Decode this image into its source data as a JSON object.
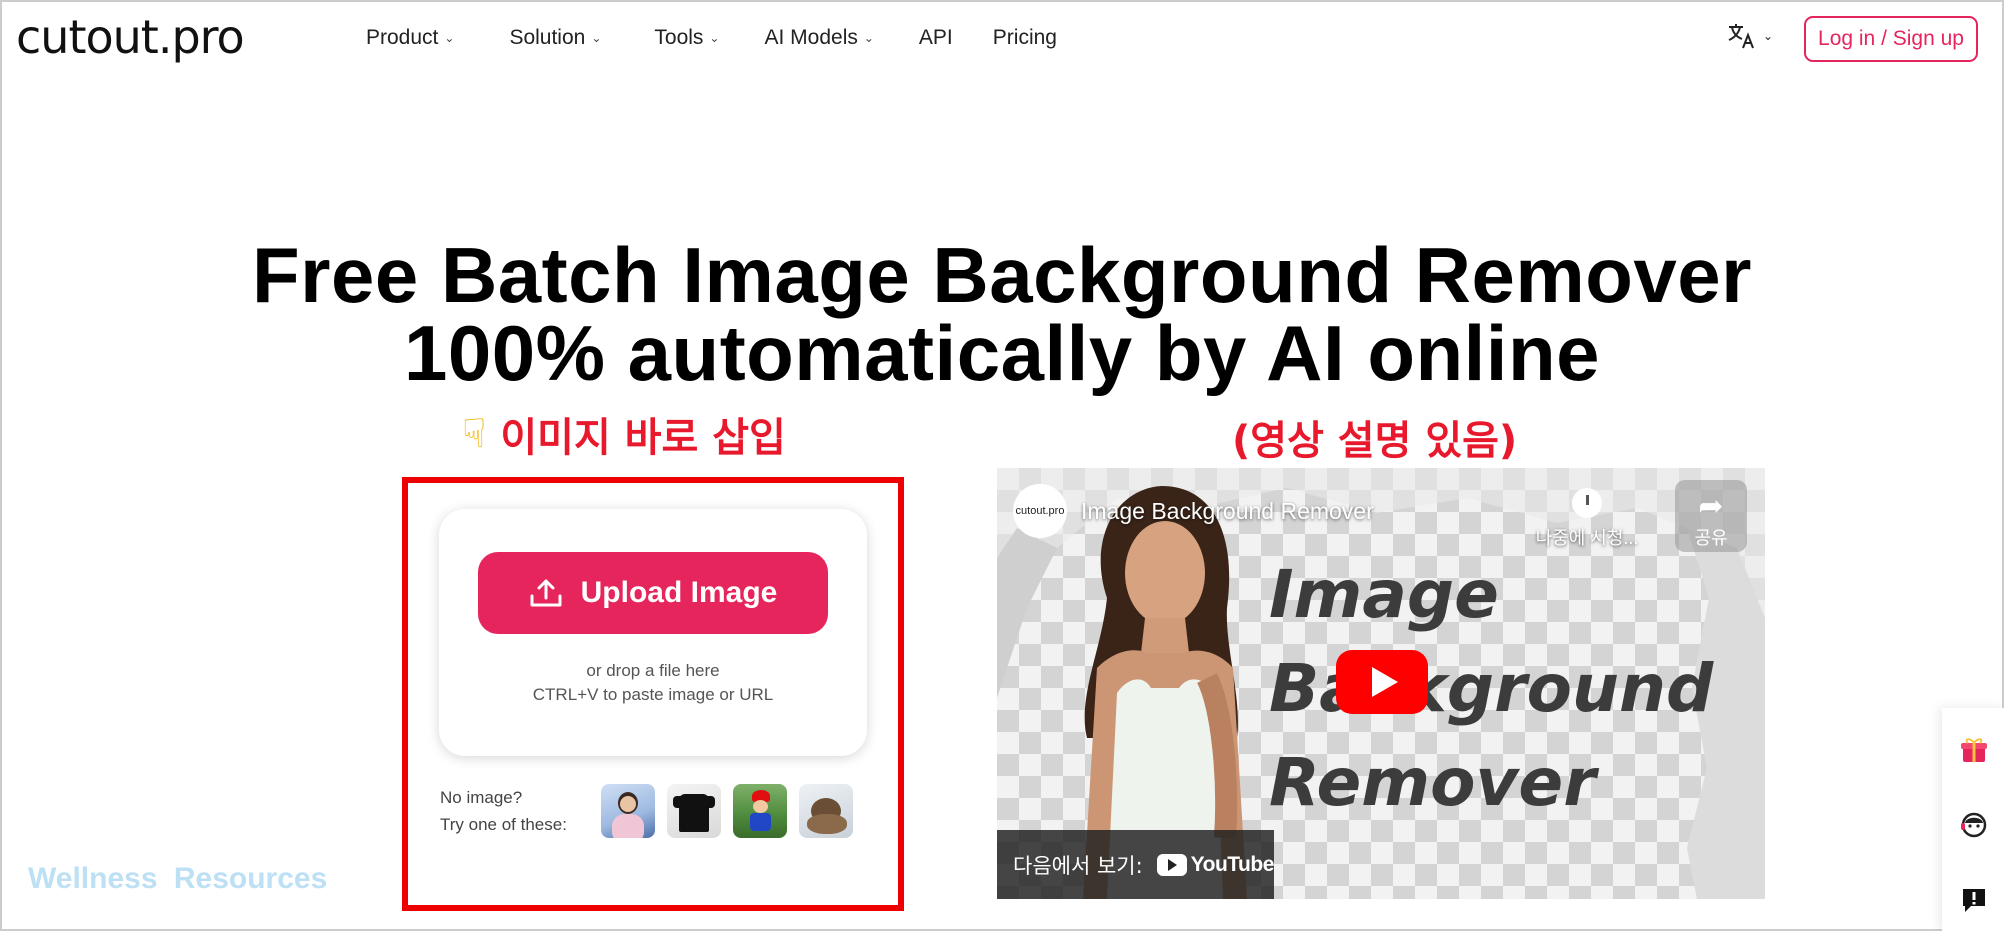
{
  "header": {
    "logo": "cutout.pro",
    "nav": [
      {
        "label": "Product",
        "has_dropdown": true
      },
      {
        "label": "Solution",
        "has_dropdown": true
      },
      {
        "label": "Tools",
        "has_dropdown": true
      },
      {
        "label": "AI Models",
        "has_dropdown": true
      },
      {
        "label": "API",
        "has_dropdown": false
      },
      {
        "label": "Pricing",
        "has_dropdown": false
      }
    ],
    "language_icon": "translate-icon",
    "login_label": "Log in / Sign up"
  },
  "hero": {
    "title_line1": "Free Batch Image Background Remover",
    "title_line2": "100% automatically by AI online"
  },
  "annotations": {
    "left_text": "이미지 바로 삽입",
    "left_icon": "pointing-hand-icon",
    "right_text": "(영상 설명 있음)"
  },
  "uploader": {
    "button_label": "Upload Image",
    "drop_hint": "or drop a file here",
    "paste_hint": "CTRL+V to paste image or URL",
    "try_line1": "No image?",
    "try_line2": "Try one of these:",
    "samples": [
      "girl-photo",
      "t-shirt-photo",
      "mario-figure-photo",
      "dog-photo"
    ]
  },
  "video": {
    "channel_avatar": "cutout.pro",
    "title": "Image Background Remover",
    "watch_later": "나중에 시청...",
    "share": "공유",
    "overlay_line1": "Image",
    "overlay_line2": "Background",
    "overlay_line3": "Remover",
    "watch_on_label": "다음에서 보기:",
    "youtube_label": "YouTube"
  },
  "watermark": "Wellness Resources",
  "sidebar_icons": [
    "gift-icon",
    "support-agent-icon",
    "feedback-icon"
  ],
  "colors": {
    "brand_pink": "#e6255c",
    "highlight_red": "#ee0000",
    "annotation_red": "#e8192c",
    "youtube_red": "#ff0000"
  }
}
